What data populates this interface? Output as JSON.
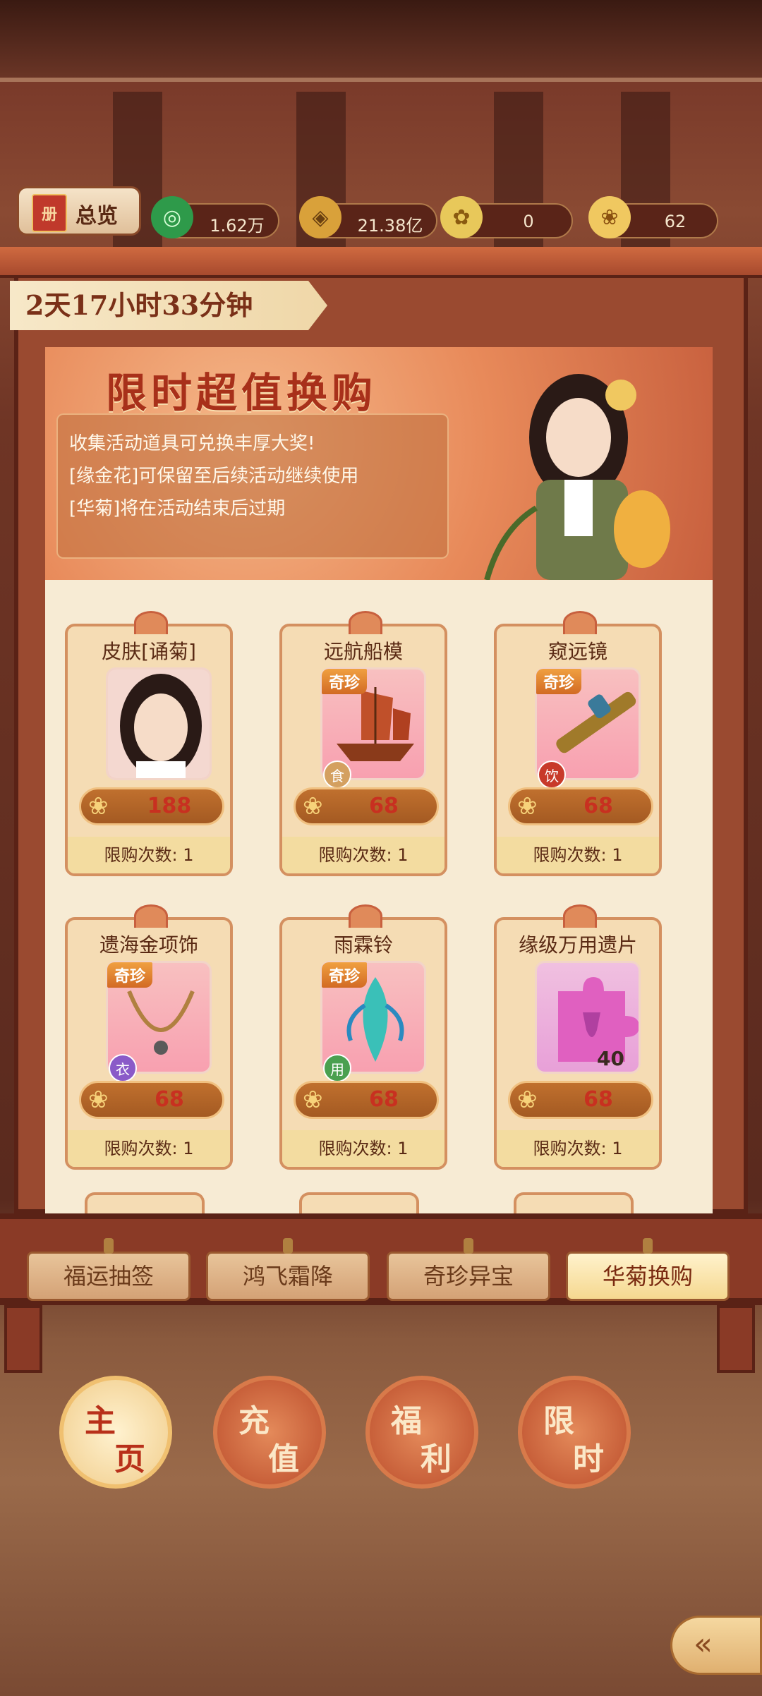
{
  "header": {
    "overview_label": "总览",
    "overview_icon": "book-icon"
  },
  "resources": [
    {
      "icon": "jade-coin-icon",
      "value": "1.62万"
    },
    {
      "icon": "gold-coin-icon",
      "value": "21.38亿"
    },
    {
      "icon": "golden-flower-icon",
      "value": "0"
    },
    {
      "icon": "chrysanthemum-icon",
      "value": "62"
    }
  ],
  "timer": "2天17小时33分钟",
  "banner": {
    "title": "限时超值换购",
    "lines": [
      "收集活动道具可兑换丰厚大奖!",
      "[缘金花]可保留至后续活动继续使用",
      "[华菊]将在活动结束后过期"
    ]
  },
  "items": [
    {
      "name": "皮肤[诵菊]",
      "tag": "",
      "type": "",
      "count": "",
      "price": "188",
      "limit": "限购次数: 1"
    },
    {
      "name": "远航船模",
      "tag": "奇珍",
      "type": "食",
      "count": "",
      "price": "68",
      "limit": "限购次数: 1"
    },
    {
      "name": "窥远镜",
      "tag": "奇珍",
      "type": "饮",
      "count": "",
      "price": "68",
      "limit": "限购次数: 1"
    },
    {
      "name": "遗海金项饰",
      "tag": "奇珍",
      "type": "衣",
      "count": "",
      "price": "68",
      "limit": "限购次数: 1"
    },
    {
      "name": "雨霖铃",
      "tag": "奇珍",
      "type": "用",
      "count": "",
      "price": "68",
      "limit": "限购次数: 1"
    },
    {
      "name": "缘级万用遗片",
      "tag": "",
      "type": "",
      "count": "40",
      "price": "68",
      "limit": "限购次数: 1"
    }
  ],
  "tabs": [
    "福运抽签",
    "鸿飞霜降",
    "奇珍异宝",
    "华菊换购"
  ],
  "nav": [
    {
      "c1": "主",
      "c2": "页"
    },
    {
      "c1": "充",
      "c2": "值"
    },
    {
      "c1": "福",
      "c2": "利"
    },
    {
      "c1": "限",
      "c2": "时"
    }
  ],
  "colors": {
    "accent": "#a8301a",
    "frame": "#9a4a30",
    "gold": "#f7d27a"
  }
}
